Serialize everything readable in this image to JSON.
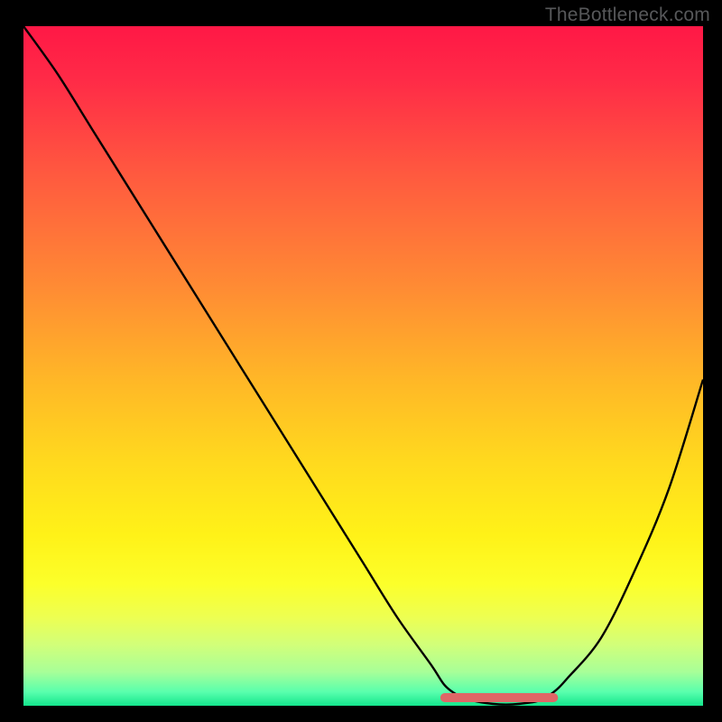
{
  "watermark": "TheBottleneck.com",
  "chart_data": {
    "type": "line",
    "title": "",
    "xlabel": "",
    "ylabel": "",
    "xlim": [
      0,
      100
    ],
    "ylim": [
      0,
      100
    ],
    "series": [
      {
        "name": "bottleneck-curve",
        "x": [
          0,
          5,
          10,
          15,
          20,
          25,
          30,
          35,
          40,
          45,
          50,
          55,
          60,
          62,
          64,
          66,
          68,
          70,
          72,
          74,
          76,
          78,
          80,
          85,
          90,
          95,
          100
        ],
        "y": [
          100,
          93,
          85,
          77,
          69,
          61,
          53,
          45,
          37,
          29,
          21,
          13,
          6,
          3,
          1.5,
          0.8,
          0.4,
          0.2,
          0.2,
          0.4,
          0.8,
          2,
          4,
          10,
          20,
          32,
          48
        ]
      },
      {
        "name": "optimal-range-marker",
        "x": [
          62,
          78
        ],
        "y": [
          0.5,
          0.5
        ]
      }
    ],
    "colors": {
      "curve": "#000000",
      "optimal": "#de6666"
    }
  }
}
